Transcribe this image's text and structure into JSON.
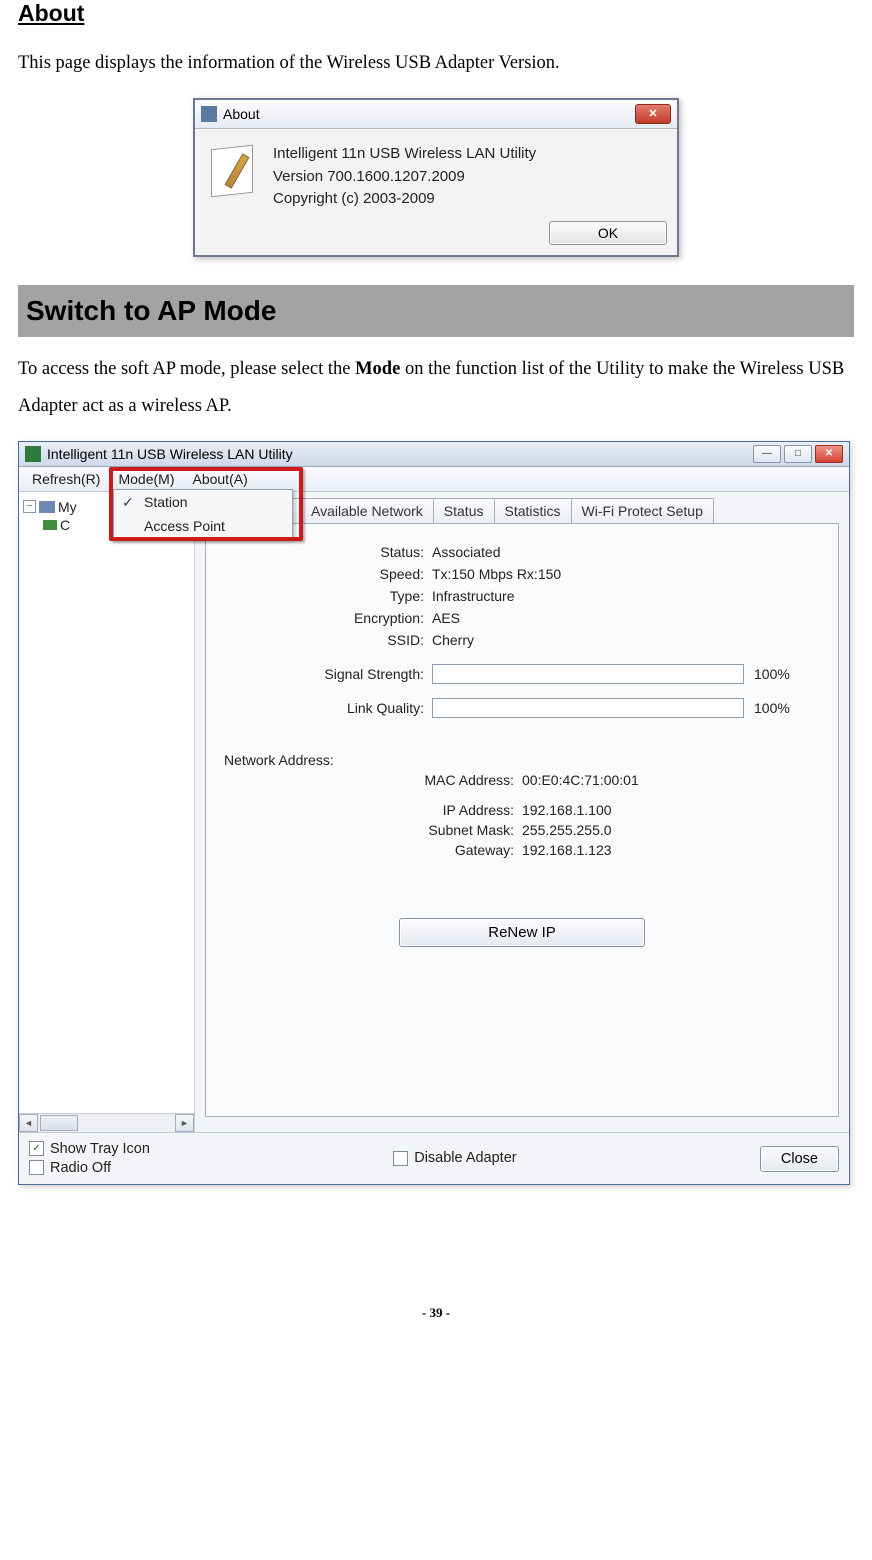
{
  "heading_about": "About",
  "intro_about": "This page displays the information of the Wireless USB Adapter Version.",
  "about_dialog": {
    "title": "About",
    "line1": "Intelligent 11n USB Wireless LAN Utility",
    "line2": "Version 700.1600.1207.2009",
    "line3": "Copyright (c) 2003-2009",
    "ok": "OK"
  },
  "band_heading": "Switch to AP Mode",
  "intro_ap_pre": "To access the soft AP mode, please select the ",
  "intro_ap_bold": "Mode",
  "intro_ap_post": " on the function list of the Utility to make the Wireless USB Adapter act as a wireless AP.",
  "util": {
    "title": "Intelligent 11n USB Wireless LAN Utility",
    "menus": {
      "refresh": "Refresh(R)",
      "mode": "Mode(M)",
      "about": "About(A)"
    },
    "mode_menu": {
      "station": "Station",
      "access_point": "Access Point"
    },
    "tree": {
      "root": "My",
      "child": "C"
    },
    "tabs": {
      "available_network": "Available Network",
      "status": "Status",
      "statistics": "Statistics",
      "wps": "Wi-Fi Protect Setup"
    },
    "status": {
      "status_label": "Status:",
      "status_value": "Associated",
      "speed_label": "Speed:",
      "speed_value": "Tx:150 Mbps Rx:150",
      "type_label": "Type:",
      "type_value": "Infrastructure",
      "encryption_label": "Encryption:",
      "encryption_value": "AES",
      "ssid_label": "SSID:",
      "ssid_value": "Cherry",
      "signal_label": "Signal Strength:",
      "signal_pct": "100%",
      "quality_label": "Link Quality:",
      "quality_pct": "100%",
      "network_address": "Network Address:",
      "mac_label": "MAC Address:",
      "mac_value": "00:E0:4C:71:00:01",
      "ip_label": "IP Address:",
      "ip_value": "192.168.1.100",
      "subnet_label": "Subnet Mask:",
      "subnet_value": "255.255.255.0",
      "gateway_label": "Gateway:",
      "gateway_value": "192.168.1.123",
      "renew": "ReNew IP"
    },
    "bottom": {
      "show_tray": "Show Tray Icon",
      "radio_off": "Radio Off",
      "disable_adapter": "Disable Adapter",
      "close": "Close"
    }
  },
  "page_number": "- 39 -"
}
